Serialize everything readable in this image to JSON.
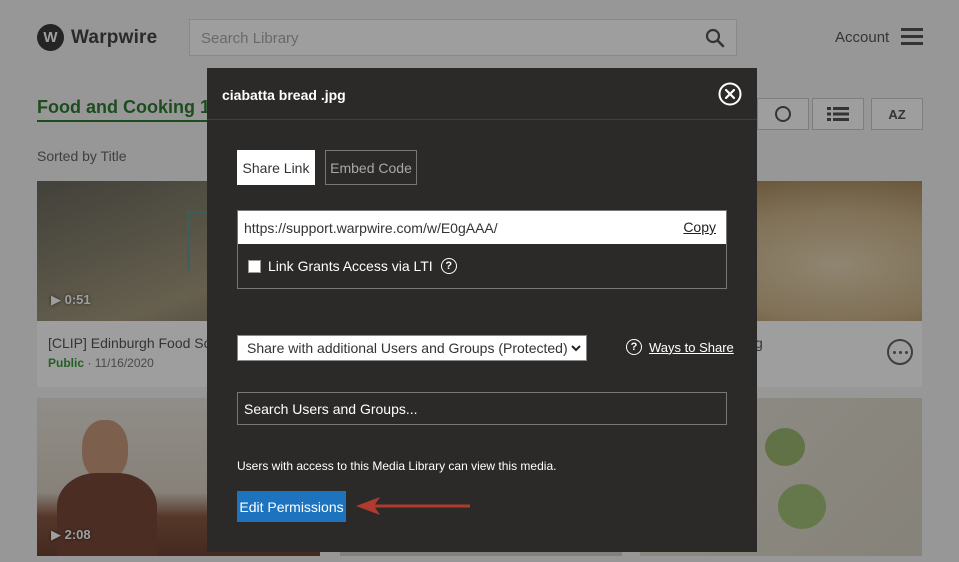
{
  "app": {
    "brand": "Warpwire",
    "search_placeholder": "Search Library",
    "account_label": "Account"
  },
  "library": {
    "title": "Food and Cooking 1",
    "sorted_label": "Sorted by Title",
    "cards": [
      {
        "title": "[CLIP] Edinburgh Food So",
        "status": "Public",
        "date": "· 11/16/2020",
        "duration": "0:51"
      },
      {
        "title": "g",
        "status": "",
        "date": "",
        "duration": ""
      },
      {
        "title": "",
        "status": "",
        "date": "",
        "duration": "2:08"
      }
    ],
    "view_buttons": {
      "sort_az": "AZ"
    }
  },
  "modal": {
    "title": "ciabatta bread .jpg",
    "tabs": {
      "share_link": "Share Link",
      "embed_code": "Embed Code"
    },
    "share_url": "https://support.warpwire.com/w/E0gAAA/",
    "copy_label": "Copy",
    "lti_label": "Link Grants Access via LTI",
    "share_select_value": "Share with additional Users and Groups (Protected)",
    "ways_to_share": "Ways to Share",
    "search_users_placeholder": "Search Users and Groups...",
    "access_note": "Users with access to this Media Library can view this media.",
    "edit_permissions": "Edit Permissions"
  },
  "colors": {
    "modal_bg": "#2b2a29",
    "accent_blue": "#1e73be",
    "library_green": "#2f7d32",
    "annotation_arrow": "#b03a2e"
  }
}
